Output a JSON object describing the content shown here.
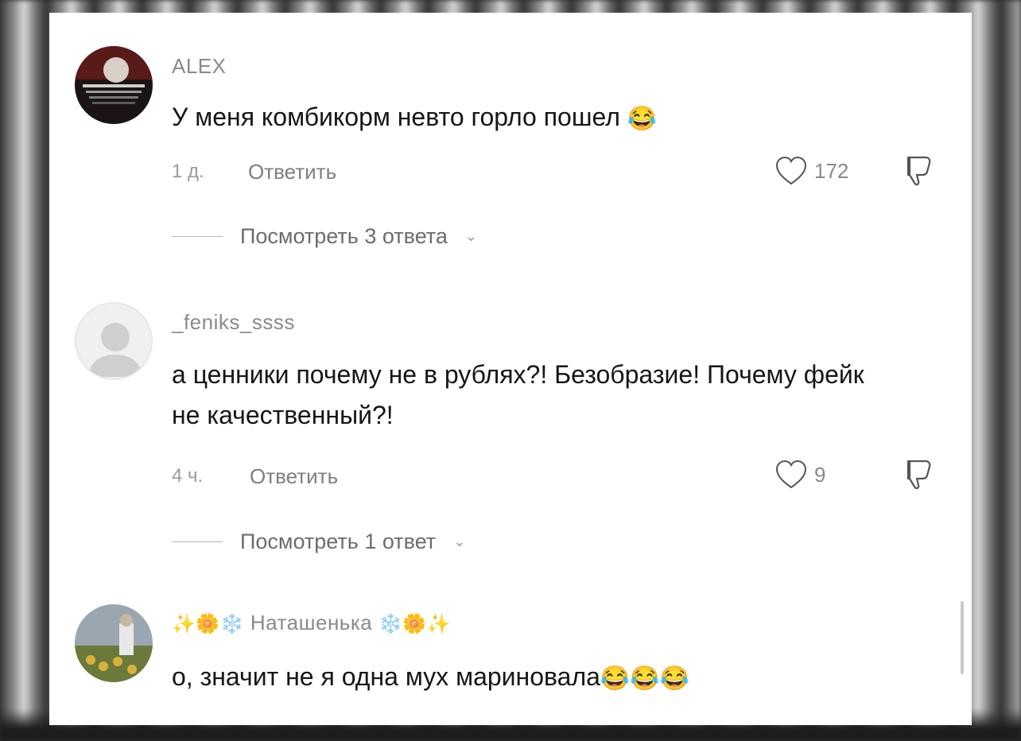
{
  "comments": [
    {
      "username": "ALEX",
      "text": "У меня комбикорм невто горло пошел",
      "emoji": "😂",
      "age": "1 д.",
      "reply_label": "Ответить",
      "likes": "172",
      "view_replies": "Посмотреть 3 ответа"
    },
    {
      "username": "_feniks_ssss",
      "text": "а ценники почему не в рублях?! Безобразие! Почему фейк не качественный?!",
      "age": "4 ч.",
      "reply_label": "Ответить",
      "likes": "9",
      "view_replies": "Посмотреть 1 ответ"
    },
    {
      "username_prefix": "✨🌼❄️",
      "username": "Наташенька",
      "username_suffix": "❄️🌼✨",
      "text": "о, значит не я одна мух мариновала",
      "emoji": "😂😂😂"
    }
  ],
  "colors": {
    "panel": "#ffffff",
    "text": "#161616",
    "muted": "#8a8a8a"
  },
  "icons": [
    "heart-icon",
    "dislike-icon",
    "chevron-down-icon"
  ]
}
